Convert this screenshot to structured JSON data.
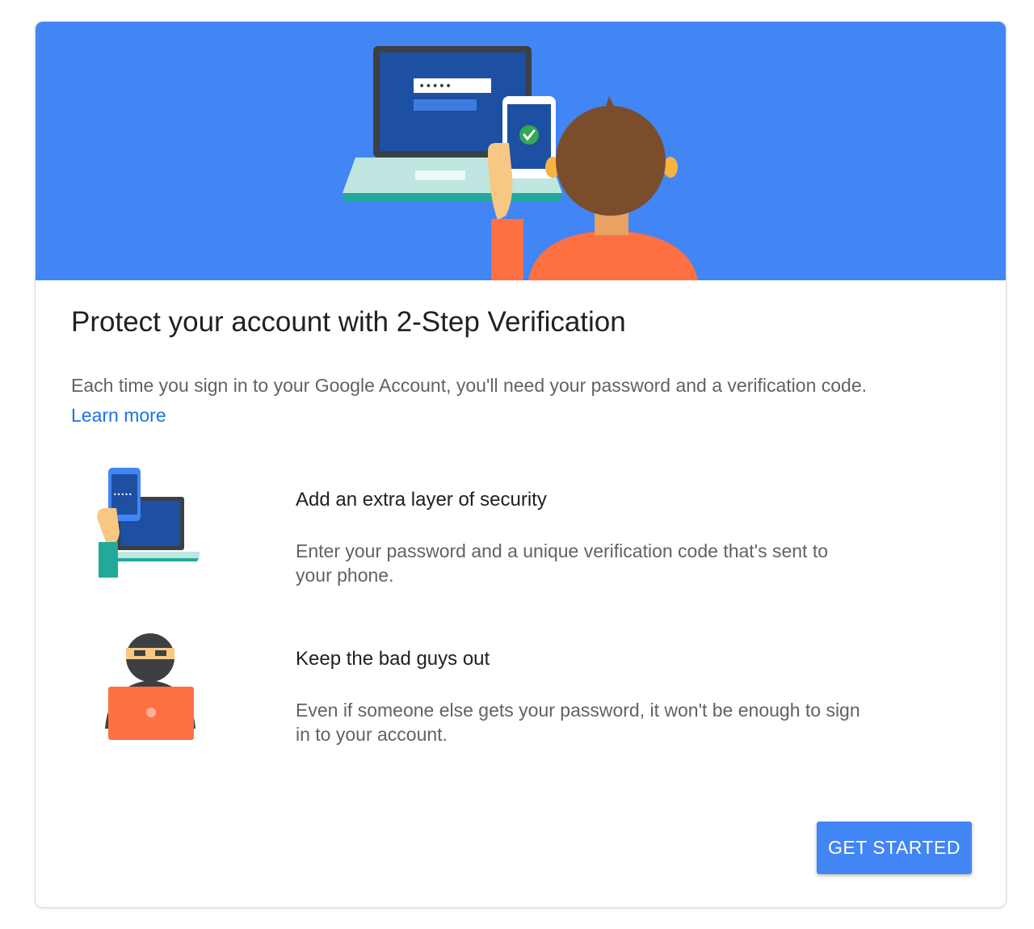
{
  "colors": {
    "hero_background": "#4285f4",
    "link": "#1a73e8",
    "button_background": "#4285f4",
    "button_text": "#ffffff",
    "title_text": "#202124",
    "body_text": "#5f6368"
  },
  "hero": {
    "illustration": "person-verifying-laptop-login-with-phone",
    "password_mask": "•••••"
  },
  "content": {
    "title": "Protect your account with 2-Step Verification",
    "description": "Each time you sign in to your Google Account, you'll need your password and a verification code.",
    "learn_more": "Learn more"
  },
  "features": [
    {
      "icon": "phone-laptop-icon",
      "title": "Add an extra layer of security",
      "text": "Enter your password and a unique verification code that's sent to your phone."
    },
    {
      "icon": "hacker-icon",
      "title": "Keep the bad guys out",
      "text": "Even if someone else gets your password, it won't be enough to sign in to your account."
    }
  ],
  "actions": {
    "get_started": "GET STARTED"
  }
}
